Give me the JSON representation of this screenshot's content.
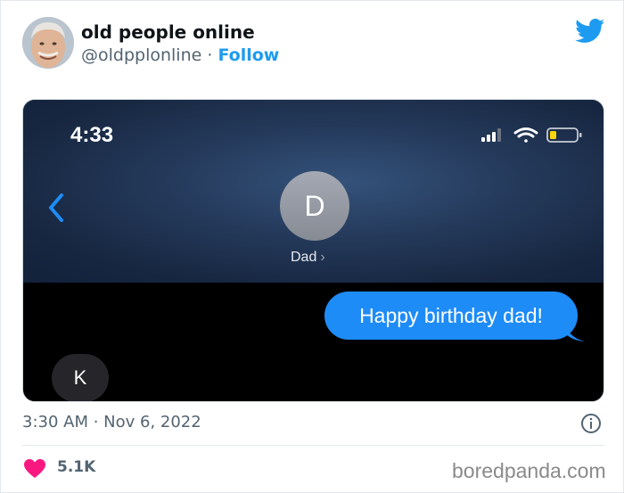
{
  "tweet": {
    "author_name": "old people online",
    "handle": "@oldpplonline",
    "separator": " · ",
    "follow_label": "Follow",
    "timestamp": "3:30 AM · Nov 6, 2022",
    "likes": "5.1K"
  },
  "phone": {
    "time": "4:33",
    "contact_initial": "D",
    "contact_name": "Dad",
    "contact_chevron": "›",
    "sent_message": "Happy birthday dad!",
    "received_message": "K"
  },
  "watermark": "boredpanda.com",
  "colors": {
    "twitter_blue": "#1d9bf0",
    "imessage_blue": "#1e8cf7",
    "heart_pink": "#f91880",
    "battery_yellow": "#ffd60a"
  },
  "icons": [
    "twitter-bird-icon",
    "back-chevron-icon",
    "signal-icon",
    "wifi-icon",
    "battery-icon",
    "info-icon",
    "heart-icon"
  ]
}
